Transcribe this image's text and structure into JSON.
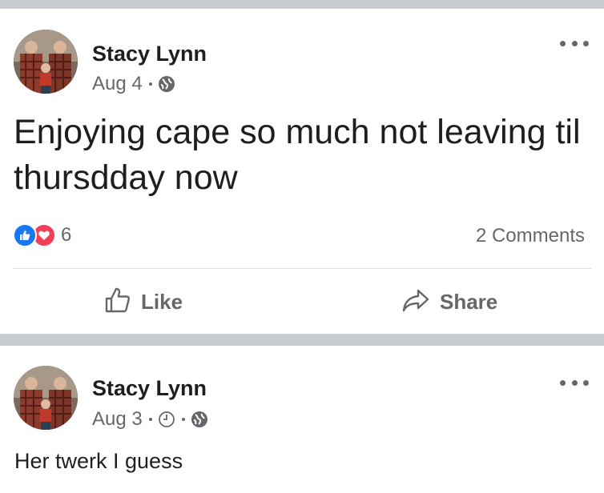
{
  "colors": {
    "separator": "#c9ccd1",
    "text_primary": "#1c1e21",
    "text_secondary": "#65676b",
    "like_blue": "#1877f2",
    "love_red": "#f33e58"
  },
  "posts": [
    {
      "author": "Stacy Lynn",
      "date": "Aug 4",
      "icons": [
        "globe-icon"
      ],
      "text": "Enjoying cape so much not leaving til thursdday now",
      "reactions": {
        "types": [
          "like-reaction-icon",
          "love-reaction-icon"
        ],
        "count": "6"
      },
      "comments": "2 Comments",
      "actions": {
        "like_label": "Like",
        "share_label": "Share"
      }
    },
    {
      "author": "Stacy Lynn",
      "date": "Aug 3",
      "icons": [
        "clock-icon",
        "globe-icon"
      ],
      "text": "Her twerk I guess"
    }
  ]
}
